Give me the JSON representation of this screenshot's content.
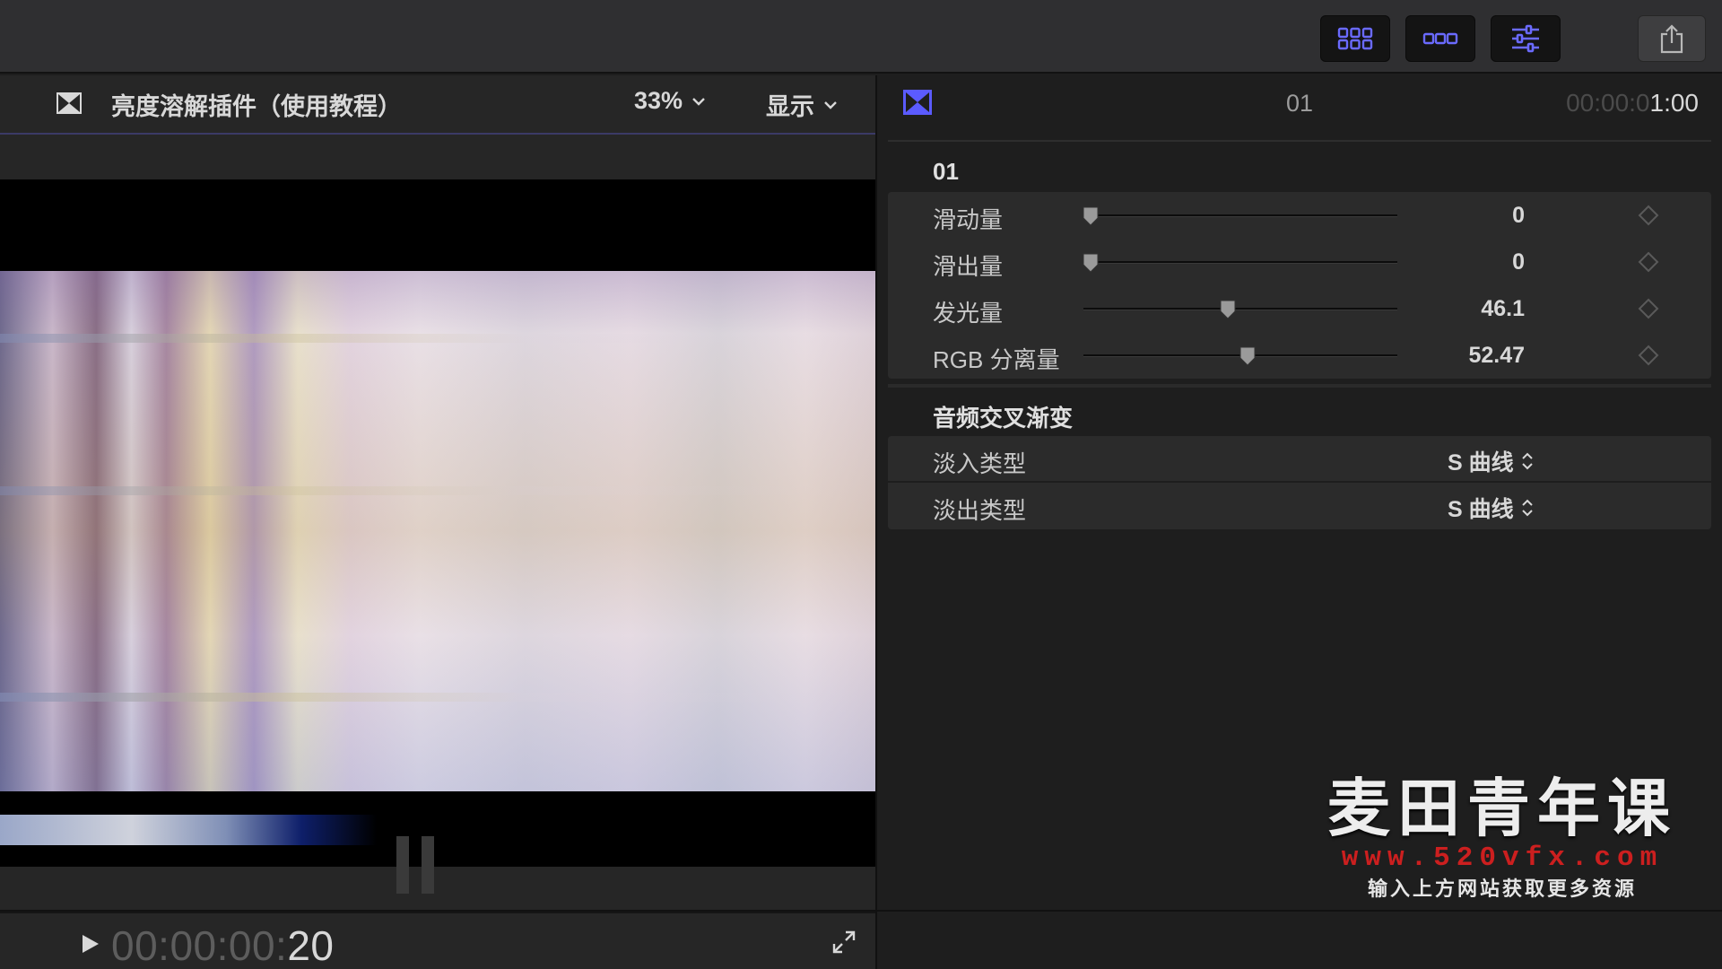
{
  "viewer": {
    "title": "亮度溶解插件（使用教程）",
    "zoom": "33%",
    "display_menu": "显示",
    "timecode_dim": "00:00:00:",
    "timecode_active": "20"
  },
  "inspector": {
    "clip_name": "01",
    "duration_dim": "00:00:0",
    "duration_active": "1:00",
    "section_effect": "01",
    "params": [
      {
        "label": "滑动量",
        "value": "0",
        "level": 0.0
      },
      {
        "label": "滑出量",
        "value": "0",
        "level": 0.0
      },
      {
        "label": "发光量",
        "value": "46.1",
        "level": 0.461
      },
      {
        "label": "RGB 分离量",
        "value": "52.47",
        "level": 0.5247
      }
    ],
    "section_audio": "音频交叉渐变",
    "fade_in_label": "淡入类型",
    "fade_in_value": "S 曲线",
    "fade_out_label": "淡出类型",
    "fade_out_value": "S 曲线"
  },
  "watermark": {
    "title": "麦田青年课",
    "url": "www.520vfx.com",
    "subtitle": "输入上方网站获取更多资源"
  },
  "colors": {
    "accent": "#5b5bff",
    "watermark_url": "#cc1f1f",
    "panel_bg": "#2b2b2b"
  },
  "icons": {
    "toolbar": [
      "browser-grid-icon",
      "timeline-icon",
      "inspector-sliders-icon",
      "share-icon"
    ],
    "viewer": [
      "transition-icon",
      "play-icon",
      "fullscreen-icon"
    ]
  }
}
